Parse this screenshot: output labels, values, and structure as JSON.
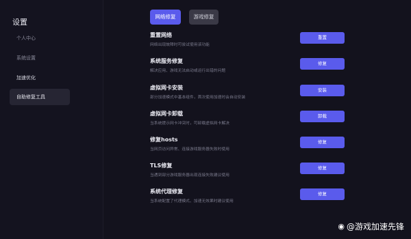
{
  "sidebar": {
    "title": "设置",
    "items": [
      {
        "label": "个人中心"
      },
      {
        "label": "系统设置"
      },
      {
        "label": "加速优化"
      },
      {
        "label": "自助修复工具"
      }
    ]
  },
  "tabs": [
    {
      "label": "网络修复"
    },
    {
      "label": "游戏修复"
    }
  ],
  "repairs": [
    {
      "title": "重置网络",
      "desc": "网络出现故障时可尝试使用该功能",
      "button": "重置"
    },
    {
      "title": "系统服务修复",
      "desc": "解决应用、游戏无法启动或运行出错的问题",
      "button": "修复"
    },
    {
      "title": "虚拟网卡安装",
      "desc": "部分加速模式中基本组件，首次使用加速时会自动安装",
      "button": "安装"
    },
    {
      "title": "虚拟网卡卸载",
      "desc": "当系统提示网卡冲突时，可卸载虚拟网卡解决",
      "button": "卸载"
    },
    {
      "title": "修复hosts",
      "desc": "当网页访问异常、连接游戏服务器失败时使用",
      "button": "修复"
    },
    {
      "title": "TLS修复",
      "desc": "当遇到部分游戏服务器出现连接失败建议使用",
      "button": "修复"
    },
    {
      "title": "系统代理修复",
      "desc": "当系统配置了代理模式、加速无效果时建议使用",
      "button": "修复"
    }
  ],
  "watermark": {
    "icon": "weibo-icon",
    "text": "@游戏加速先锋"
  }
}
